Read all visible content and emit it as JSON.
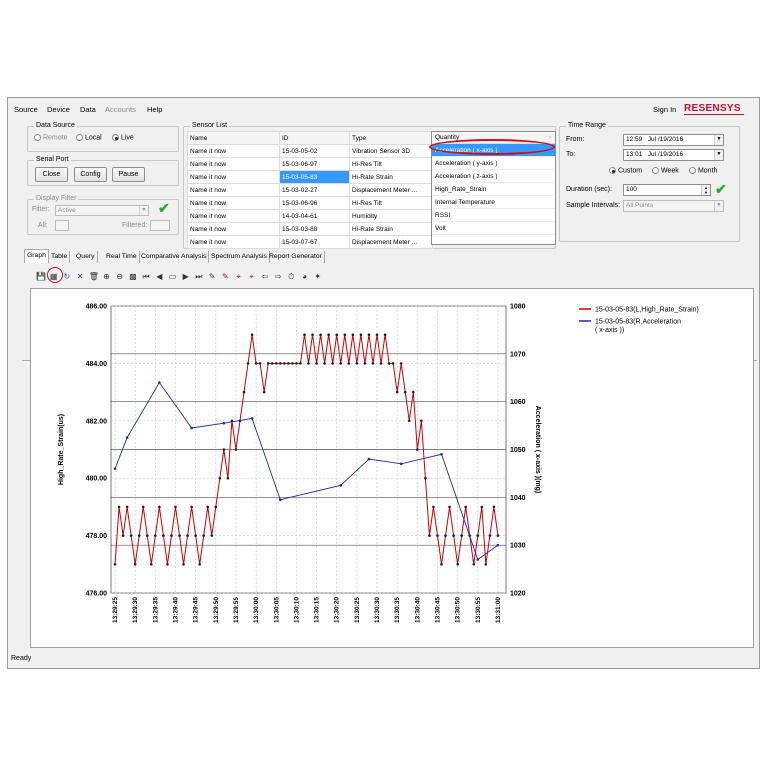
{
  "menu": {
    "source": "Source",
    "device": "Device",
    "data": "Data",
    "accounts": "Accounts",
    "help": "Help",
    "sign_in": "Sign In",
    "brand": "RESENSYS"
  },
  "data_source": {
    "title": "Data Source",
    "options": [
      "Remote",
      "Local",
      "Live"
    ],
    "selected": "Live"
  },
  "serial_port": {
    "title": "Serial Port",
    "close": "Close",
    "config": "Config",
    "pause": "Pause"
  },
  "display_filter": {
    "title": "Display Filter",
    "filter_label": "Filter:",
    "filter_value": "Active",
    "all_label": "All:",
    "filtered_label": "Filtered:"
  },
  "sensor_list": {
    "title": "Sensor List",
    "columns": [
      "Name",
      "ID",
      "Type"
    ],
    "rows": [
      [
        "Name it now",
        "15-03-05-02",
        "Vibration Sensor 3D"
      ],
      [
        "Name it now",
        "15-03-06-97",
        "Hi-Res Tilt"
      ],
      [
        "Name it now",
        "15-03-05-83",
        "Hi-Rate Strain"
      ],
      [
        "Name it now",
        "15-03-02-27",
        "Displacement Meter ..."
      ],
      [
        "Name it now",
        "15-03-06-96",
        "Hi-Res Tilt"
      ],
      [
        "Name it now",
        "14-03-04-61",
        "Humidity"
      ],
      [
        "Name it now",
        "15-03-03-88",
        "Hi-Rate Strain"
      ],
      [
        "Name it now",
        "15-03-07-67",
        "Displacement Meter ..."
      ]
    ],
    "selected_row": 2
  },
  "quantity": {
    "header": "Quantity",
    "items": [
      "Acceleration ( x-axis )",
      "Acceleration ( y-axis )",
      "Acceleration ( z-axis )",
      "High_Rate_Strain",
      "Internal Temperature",
      "RSSI",
      "Volt"
    ],
    "selected_index": 0
  },
  "time_range": {
    "title": "Time Range",
    "from_label": "From:",
    "from_time": "12:59",
    "from_date": "Jul /19/2016",
    "to_label": "To:",
    "to_time": "13:01",
    "to_date": "Jul /19/2016",
    "modes": [
      "Custom",
      "Week",
      "Month"
    ],
    "selected_mode": "Custom",
    "duration_label": "Duration (sec):",
    "duration_value": "100",
    "interval_label": "Sample Intervals:",
    "interval_value": "All Points"
  },
  "tabs": [
    "Graph",
    "Table",
    "Query",
    "Real Time",
    "Comparative Analysis",
    "Spectrum Analysis",
    "Report Generator"
  ],
  "active_tab": "Graph",
  "toolbar_icons": [
    "save-icon",
    "chart-settings-icon",
    "refresh-icon",
    "cross-icon",
    "trash-icon",
    "zoom-in-icon",
    "zoom-out-icon",
    "color-grid-icon",
    "first-icon",
    "prev-icon",
    "monitor-icon",
    "next-icon",
    "last-icon",
    "pen-icon",
    "red-pen-icon",
    "cursor-icon",
    "red-cursor-icon",
    "arrow-left-icon",
    "arrow-right-icon",
    "stopwatch-icon",
    "palette-icon",
    "pin-icon"
  ],
  "status_text": "Ready",
  "colors": {
    "strain": "#cc0000",
    "accel": "#1f2aa8",
    "selected": "#3399ff",
    "highlight_ring": "#d01010"
  },
  "chart_data": {
    "type": "line",
    "ylabel_left": "High_Rate_Strain(us)",
    "ylabel_right": "Acceleration ( x-axis )(mg)",
    "ylim_left": [
      476,
      486
    ],
    "ylim_right": [
      1020,
      1080
    ],
    "left_ticks": [
      "486.00",
      "484.00",
      "482.00",
      "480.00",
      "478.00",
      "476.00"
    ],
    "right_ticks": [
      "1080",
      "1070",
      "1060",
      "1050",
      "1040",
      "1030",
      "1020"
    ],
    "x_ticks": [
      "13:29:25",
      "13:29:30",
      "13:29:35",
      "13:29:40",
      "13:29:45",
      "13:29:50",
      "13:29:55",
      "13:30:00",
      "13:30:05",
      "13:30:10",
      "13:30:15",
      "13:30:20",
      "13:30:25",
      "13:30:30",
      "13:30:35",
      "13:30:40",
      "13:30:45",
      "13:30:50",
      "13:30:55",
      "13:31:00"
    ],
    "xlim_sec": [
      -1,
      97
    ],
    "legend_position": "top-right",
    "series": [
      {
        "name": "15-03-05-83(L,High_Rate_Strain)",
        "axis": "left",
        "x": [
          0,
          1,
          2,
          3,
          4,
          5,
          6,
          7,
          8,
          9,
          10,
          11,
          12,
          13,
          14,
          15,
          16,
          17,
          18,
          19,
          20,
          21,
          22,
          23,
          24,
          25,
          26,
          27,
          28,
          29,
          30,
          31,
          32,
          33,
          34,
          35,
          36,
          37,
          38,
          39,
          40,
          41,
          42,
          43,
          44,
          45,
          46,
          47,
          48,
          49,
          50,
          51,
          52,
          53,
          54,
          55,
          56,
          57,
          58,
          59,
          60,
          61,
          62,
          63,
          64,
          65,
          66,
          67,
          68,
          69,
          70,
          71,
          72,
          73,
          74,
          75,
          76,
          77,
          78,
          79,
          80,
          81,
          82,
          83,
          84,
          85,
          86,
          87,
          88,
          89,
          90,
          91,
          92,
          93,
          94,
          95
        ],
        "y": [
          477,
          479,
          478,
          479,
          478,
          477,
          478,
          479,
          478,
          477,
          478,
          479,
          478,
          477,
          478,
          479,
          478,
          477,
          478,
          479,
          478,
          477,
          478,
          479,
          478,
          479,
          480,
          481,
          480,
          482,
          481,
          482,
          483,
          484,
          485,
          484,
          484,
          483,
          484,
          484,
          484,
          484,
          484,
          484,
          484,
          484,
          484,
          485,
          484,
          485,
          484,
          485,
          484,
          485,
          484,
          485,
          484,
          485,
          484,
          485,
          484,
          485,
          484,
          485,
          484,
          485,
          484,
          485,
          484,
          484,
          483,
          484,
          483,
          482,
          483,
          481,
          482,
          480,
          478,
          479,
          478,
          477,
          478,
          479,
          478,
          477,
          478,
          479,
          478,
          477,
          478,
          479,
          477,
          478,
          479,
          478
        ]
      },
      {
        "name": "15-03-05-83(R,Acceleration ( x-axis ))",
        "axis": "right",
        "x": [
          0,
          3,
          11,
          19,
          27,
          34,
          41,
          56,
          63,
          71,
          81,
          90,
          95
        ],
        "y": [
          1046,
          1052.5,
          1064,
          1054.5,
          1055.5,
          1056.5,
          1039.5,
          1042.5,
          1048,
          1047,
          1049,
          1027,
          1030
        ]
      }
    ]
  }
}
